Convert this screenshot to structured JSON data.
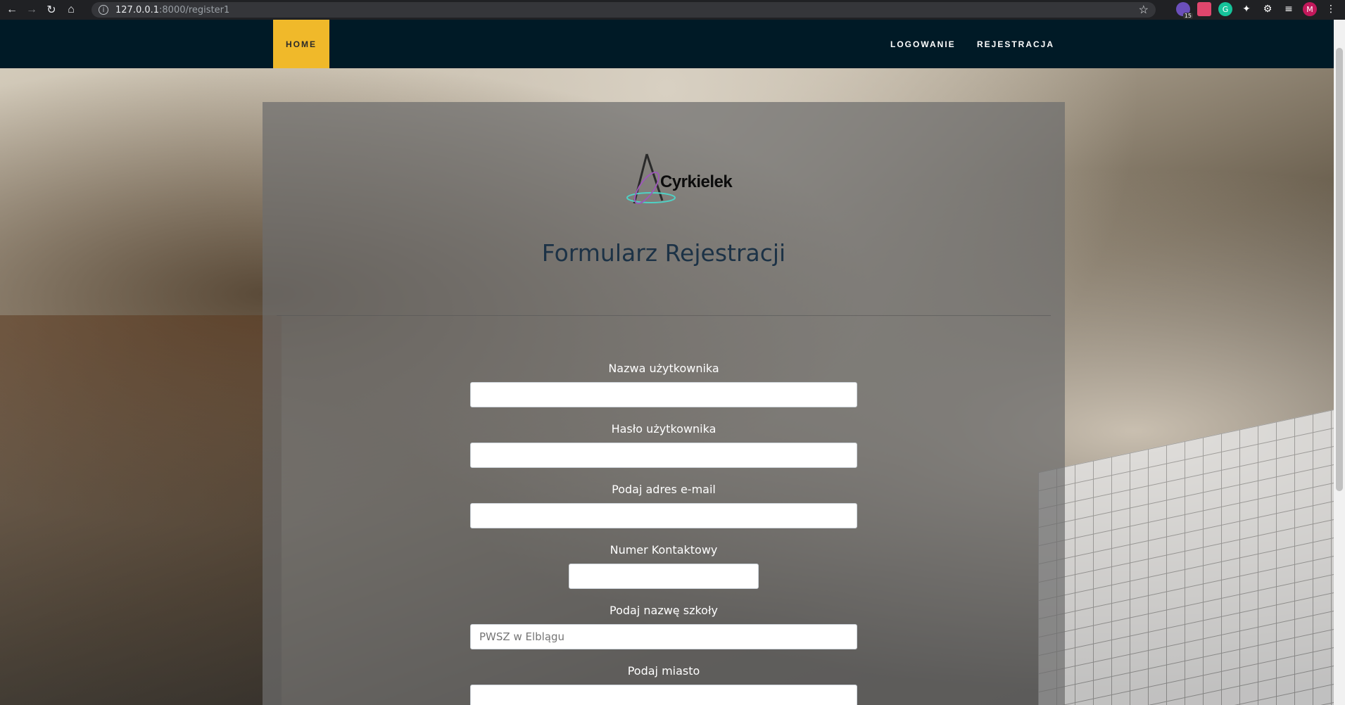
{
  "browser": {
    "url_host": "127.0.0.1",
    "url_rest": ":8000/register1",
    "badge_count": "15",
    "profile_initial": "M"
  },
  "nav": {
    "home": "HOME",
    "login": "LOGOWANIE",
    "register": "REJESTRACJA"
  },
  "logo": {
    "text": "Cyrkielek"
  },
  "form": {
    "title": "Formularz Rejestracji",
    "fields": [
      {
        "label": "Nazwa użytkownika",
        "placeholder": ""
      },
      {
        "label": "Hasło użytkownika",
        "placeholder": ""
      },
      {
        "label": "Podaj adres e-mail",
        "placeholder": ""
      },
      {
        "label": "Numer Kontaktowy",
        "placeholder": ""
      },
      {
        "label": "Podaj nazwę szkoły",
        "placeholder": "PWSZ w Elblągu"
      },
      {
        "label": "Podaj miasto",
        "placeholder": ""
      }
    ]
  },
  "colors": {
    "navbar": "#001a26",
    "home_accent": "#f0b92a",
    "title": "#1c3246"
  }
}
